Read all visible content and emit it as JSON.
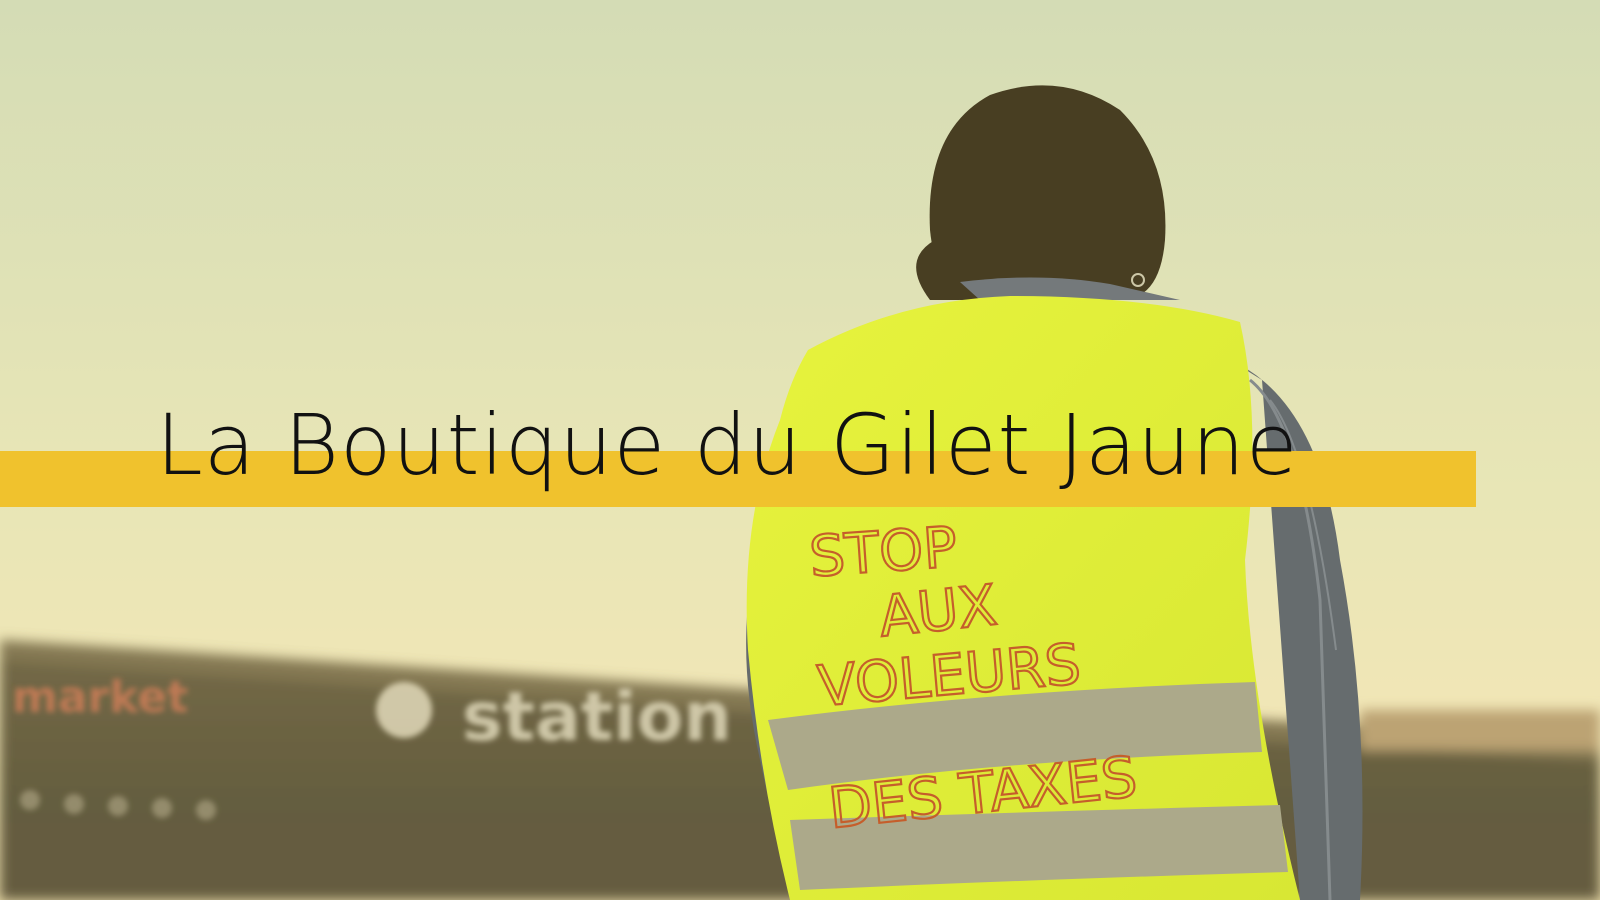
{
  "banner": {
    "title": "La Boutique du Gilet Jaune"
  },
  "photo": {
    "vest_lines": [
      "STOP",
      "AUX",
      "VOLEURS",
      "DES TAXES"
    ],
    "station_sign": "station",
    "left_sign": "market"
  },
  "colors": {
    "banner_bar": "#f0c22d",
    "vest": "#e2f23a",
    "sky_top": "#d3dec0",
    "sky_bottom": "#efe8c2"
  }
}
